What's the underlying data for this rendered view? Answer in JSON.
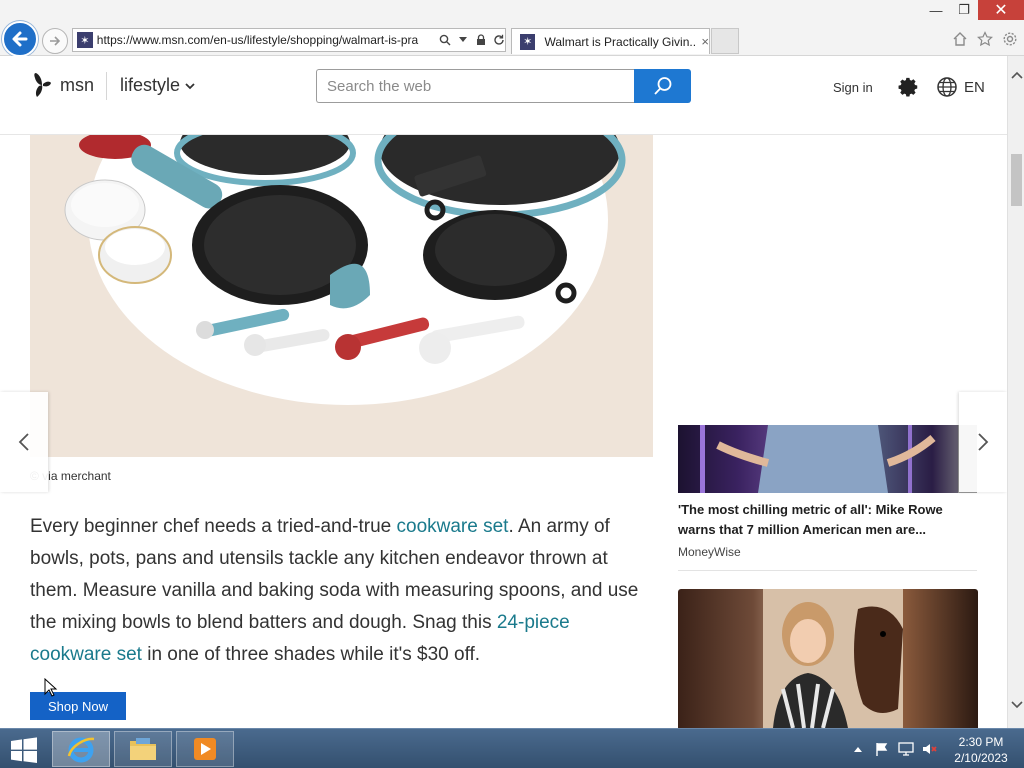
{
  "window": {
    "minimize": "—",
    "restore": "❐",
    "close": "✕"
  },
  "address_bar": {
    "url": "https://www.msn.com/en-us/lifestyle/shopping/walmart-is-pra"
  },
  "tab": {
    "title": "Walmart is Practically Givin...",
    "close": "×"
  },
  "msn_header": {
    "logo_text": "msn",
    "section": "lifestyle",
    "search_placeholder": "Search the web",
    "sign_in": "Sign in",
    "language": "EN"
  },
  "article": {
    "image_caption": "© via merchant",
    "paragraph": [
      {
        "text": "Every beginner chef needs a tried-and-true ",
        "link": false
      },
      {
        "text": "cookware set",
        "link": true
      },
      {
        "text": ". An army of bowls, pots, pans and utensils tackle any kitchen endeavor thrown at them. Measure vanilla and baking soda with measuring spoons, and use the mixing bowls to blend batters and dough. Snag this ",
        "link": false
      },
      {
        "text": "24-piece cookware set",
        "link": true
      },
      {
        "text": " in one of three shades while it's $30 off.",
        "link": false
      }
    ],
    "shop_button": "Shop Now"
  },
  "sidebar": {
    "cards": [
      {
        "title": "'The most chilling metric of all': Mike Rowe warns that 7 million American men are...",
        "source": "MoneyWise"
      }
    ]
  },
  "taskbar": {
    "apps": [
      "internet-explorer",
      "file-explorer",
      "media-player"
    ],
    "time": "2:30 PM",
    "date": "2/10/2023"
  },
  "colors": {
    "accent_blue": "#1e78d2",
    "link_teal": "#1a7a8c",
    "shop_button": "#1462c6",
    "close_red": "#c7413a"
  }
}
